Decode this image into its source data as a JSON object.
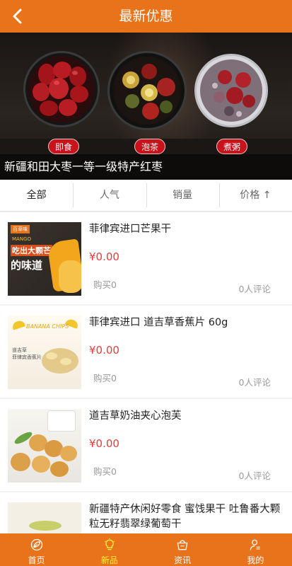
{
  "header": {
    "title": "最新优惠",
    "back_icon": "chevron-left-icon"
  },
  "banner": {
    "tags": [
      "即食",
      "泡茶",
      "煮粥"
    ],
    "caption": "新疆和田大枣一等一级特产红枣"
  },
  "sort": {
    "items": [
      {
        "label": "全部"
      },
      {
        "label": "人气"
      },
      {
        "label": "销量"
      },
      {
        "label": "价格 ↑"
      }
    ]
  },
  "products": [
    {
      "name": "菲律宾进口芒果干",
      "price": "¥0.00",
      "bought": "购买0",
      "comments": "0人评论",
      "thumb": {
        "brand": "百草味",
        "line1": "吃出大颗芒",
        "line2": "的味道",
        "sub": "MANGO"
      }
    },
    {
      "name": "菲律宾进口 道吉草香蕉片 60g",
      "price": "¥0.00",
      "bought": "购买0",
      "comments": "0人评论",
      "thumb": {
        "title": "BANANA CHIPS",
        "line1": "道吉草",
        "line2": "菲律宾香蕉片"
      }
    },
    {
      "name": "道吉草奶油夹心泡芙",
      "price": "¥0.00",
      "bought": "购买0",
      "comments": "0人评论"
    },
    {
      "name": "新疆特产休闲好零食 蜜饯果干 吐鲁番大颗粒无籽翡翠绿葡萄干"
    }
  ],
  "tabbar": {
    "items": [
      {
        "label": "首页",
        "icon": "leaf-icon"
      },
      {
        "label": "新品",
        "icon": "lightbulb-icon"
      },
      {
        "label": "资讯",
        "icon": "basket-icon"
      },
      {
        "label": "我的",
        "icon": "user-icon"
      }
    ],
    "active_color": "#fff23a"
  },
  "colors": {
    "accent": "#e8731a",
    "price": "#e23c3c",
    "tag": "#c8131d"
  }
}
